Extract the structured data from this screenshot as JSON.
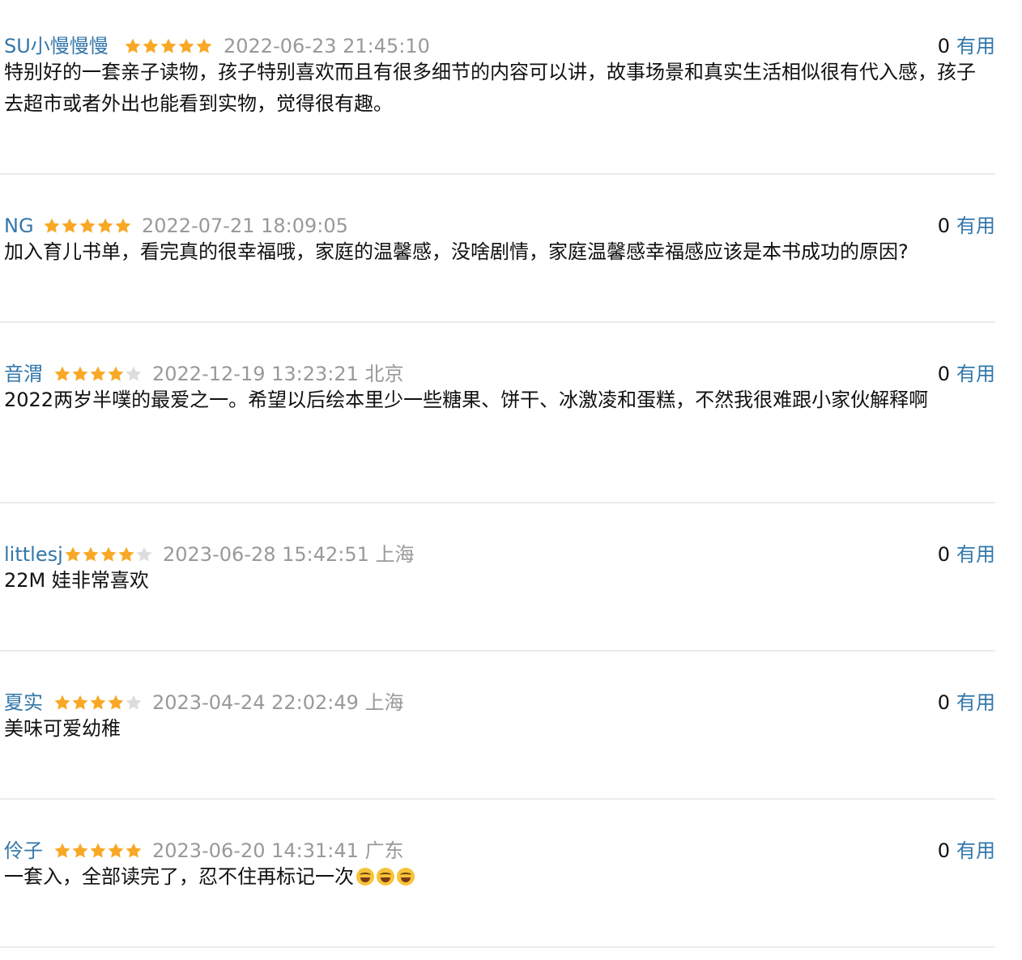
{
  "star_color": "#f9a825",
  "star_empty_color": "#dddddd",
  "link_color": "#3377aa",
  "comments": [
    {
      "user": "SU小慢慢慢",
      "rating": 5,
      "time": "2022-06-23 21:45:10",
      "location": "",
      "votes": "0",
      "vote_label": "有用",
      "content": "特别好的一套亲子读物，孩子特别喜欢而且有很多细节的内容可以讲，故事场景和真实生活相似很有代入感，孩子去超市或者外出也能看到实物，觉得很有趣。"
    },
    {
      "user": "NG",
      "rating": 5,
      "time": "2022-07-21 18:09:05",
      "location": "",
      "votes": "0",
      "vote_label": "有用",
      "content": "加入育儿书单，看完真的很幸福哦，家庭的温馨感，没啥剧情，家庭温馨感幸福感应该是本书成功的原因?"
    },
    {
      "user": "音渭",
      "rating": 4,
      "time": "2022-12-19 13:23:21",
      "location": "北京",
      "votes": "0",
      "vote_label": "有用",
      "content": "2022两岁半噗的最爱之一。希望以后绘本里少一些糖果、饼干、冰激凌和蛋糕，不然我很难跟小家伙解释啊"
    },
    {
      "user": "littlesj",
      "rating": 4,
      "time": "2023-06-28 15:42:51",
      "location": "上海",
      "votes": "0",
      "vote_label": "有用",
      "content": "22M 娃非常喜欢"
    },
    {
      "user": "夏实",
      "rating": 4,
      "time": "2023-04-24 22:02:49",
      "location": "上海",
      "votes": "0",
      "vote_label": "有用",
      "content": "美味可爱幼稚"
    },
    {
      "user": "伶子",
      "rating": 5,
      "time": "2023-06-20 14:31:41",
      "location": "广东",
      "votes": "0",
      "vote_label": "有用",
      "content": "一套入，全部读完了，忍不住再标记一次",
      "emoji": [
        "laughing-crying-emoji",
        "laughing-crying-emoji",
        "laughing-crying-emoji"
      ]
    }
  ]
}
